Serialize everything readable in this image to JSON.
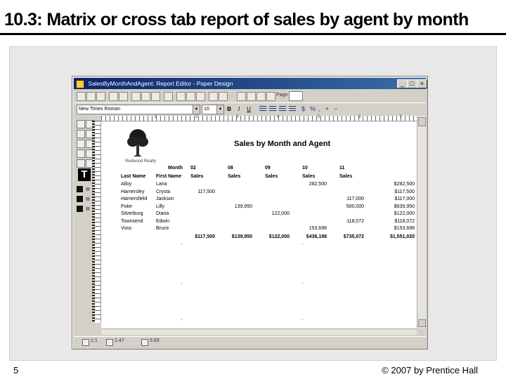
{
  "slide": {
    "title": "10.3: Matrix or cross tab report of sales by agent by month",
    "slide_number": "5",
    "copyright": "© 2007 by Prentice Hall"
  },
  "window": {
    "title": "SalesByMonthAndAgent: Report Editor - Paper Design",
    "page_label": "Page",
    "font_name": "New Times Roman",
    "font_size": "10",
    "bold_label": "B",
    "italic_label": "I",
    "underline_label": "U",
    "minimize": "_",
    "maximize": "□",
    "close": "×"
  },
  "palette": {
    "text_tool": "T"
  },
  "ruler": {
    "marks": [
      "1",
      "2",
      "3",
      "4",
      "5",
      "6",
      "7"
    ]
  },
  "report": {
    "title": "Sales by Month and Agent",
    "logo_caption": "Redwood Realty",
    "month_label": "Month",
    "col_months": [
      "02",
      "08",
      "09",
      "10",
      "11"
    ],
    "header_labels": [
      "Last Name",
      "First Name",
      "Sales",
      "Sales",
      "Sales",
      "Sales",
      "Sales"
    ],
    "rows": [
      {
        "last": "Alloy",
        "first": "Lana",
        "m02": "",
        "m08": "",
        "m09": "",
        "m10": "282,500",
        "m11": "",
        "total": "$282,500"
      },
      {
        "last": "Hamersley",
        "first": "Crysta",
        "m02": "117,500",
        "m08": "",
        "m09": "",
        "m10": "",
        "m11": "",
        "total": "$117,500"
      },
      {
        "last": "Hamersfield",
        "first": "Jackson",
        "m02": "",
        "m08": "",
        "m09": "",
        "m10": "",
        "m11": "117,000",
        "total": "$117,000"
      },
      {
        "last": "Poke",
        "first": "Lilly",
        "m02": "",
        "m08": "139,950",
        "m09": "",
        "m10": "",
        "m11": "500,000",
        "total": "$639,950"
      },
      {
        "last": "Silverburg",
        "first": "Diana",
        "m02": "",
        "m08": "",
        "m09": "122,000",
        "m10": "",
        "m11": "",
        "total": "$122,000"
      },
      {
        "last": "Townsend",
        "first": "Edwin",
        "m02": "",
        "m08": "",
        "m09": "",
        "m10": "",
        "m11": "118,072",
        "total": "$118,072"
      },
      {
        "last": "Voss",
        "first": "Bruce",
        "m02": "",
        "m08": "",
        "m09": "",
        "m10": "153,698",
        "m11": "",
        "total": "$153,698"
      }
    ],
    "totals": {
      "m02": "$117,500",
      "m08": "$139,950",
      "m09": "$122,000",
      "m10": "$436,198",
      "m11": "$735,072",
      "grand": "$1,551,020"
    }
  },
  "status": {
    "item1": "1:1",
    "item2": "2.47",
    "item3": "3.69"
  }
}
